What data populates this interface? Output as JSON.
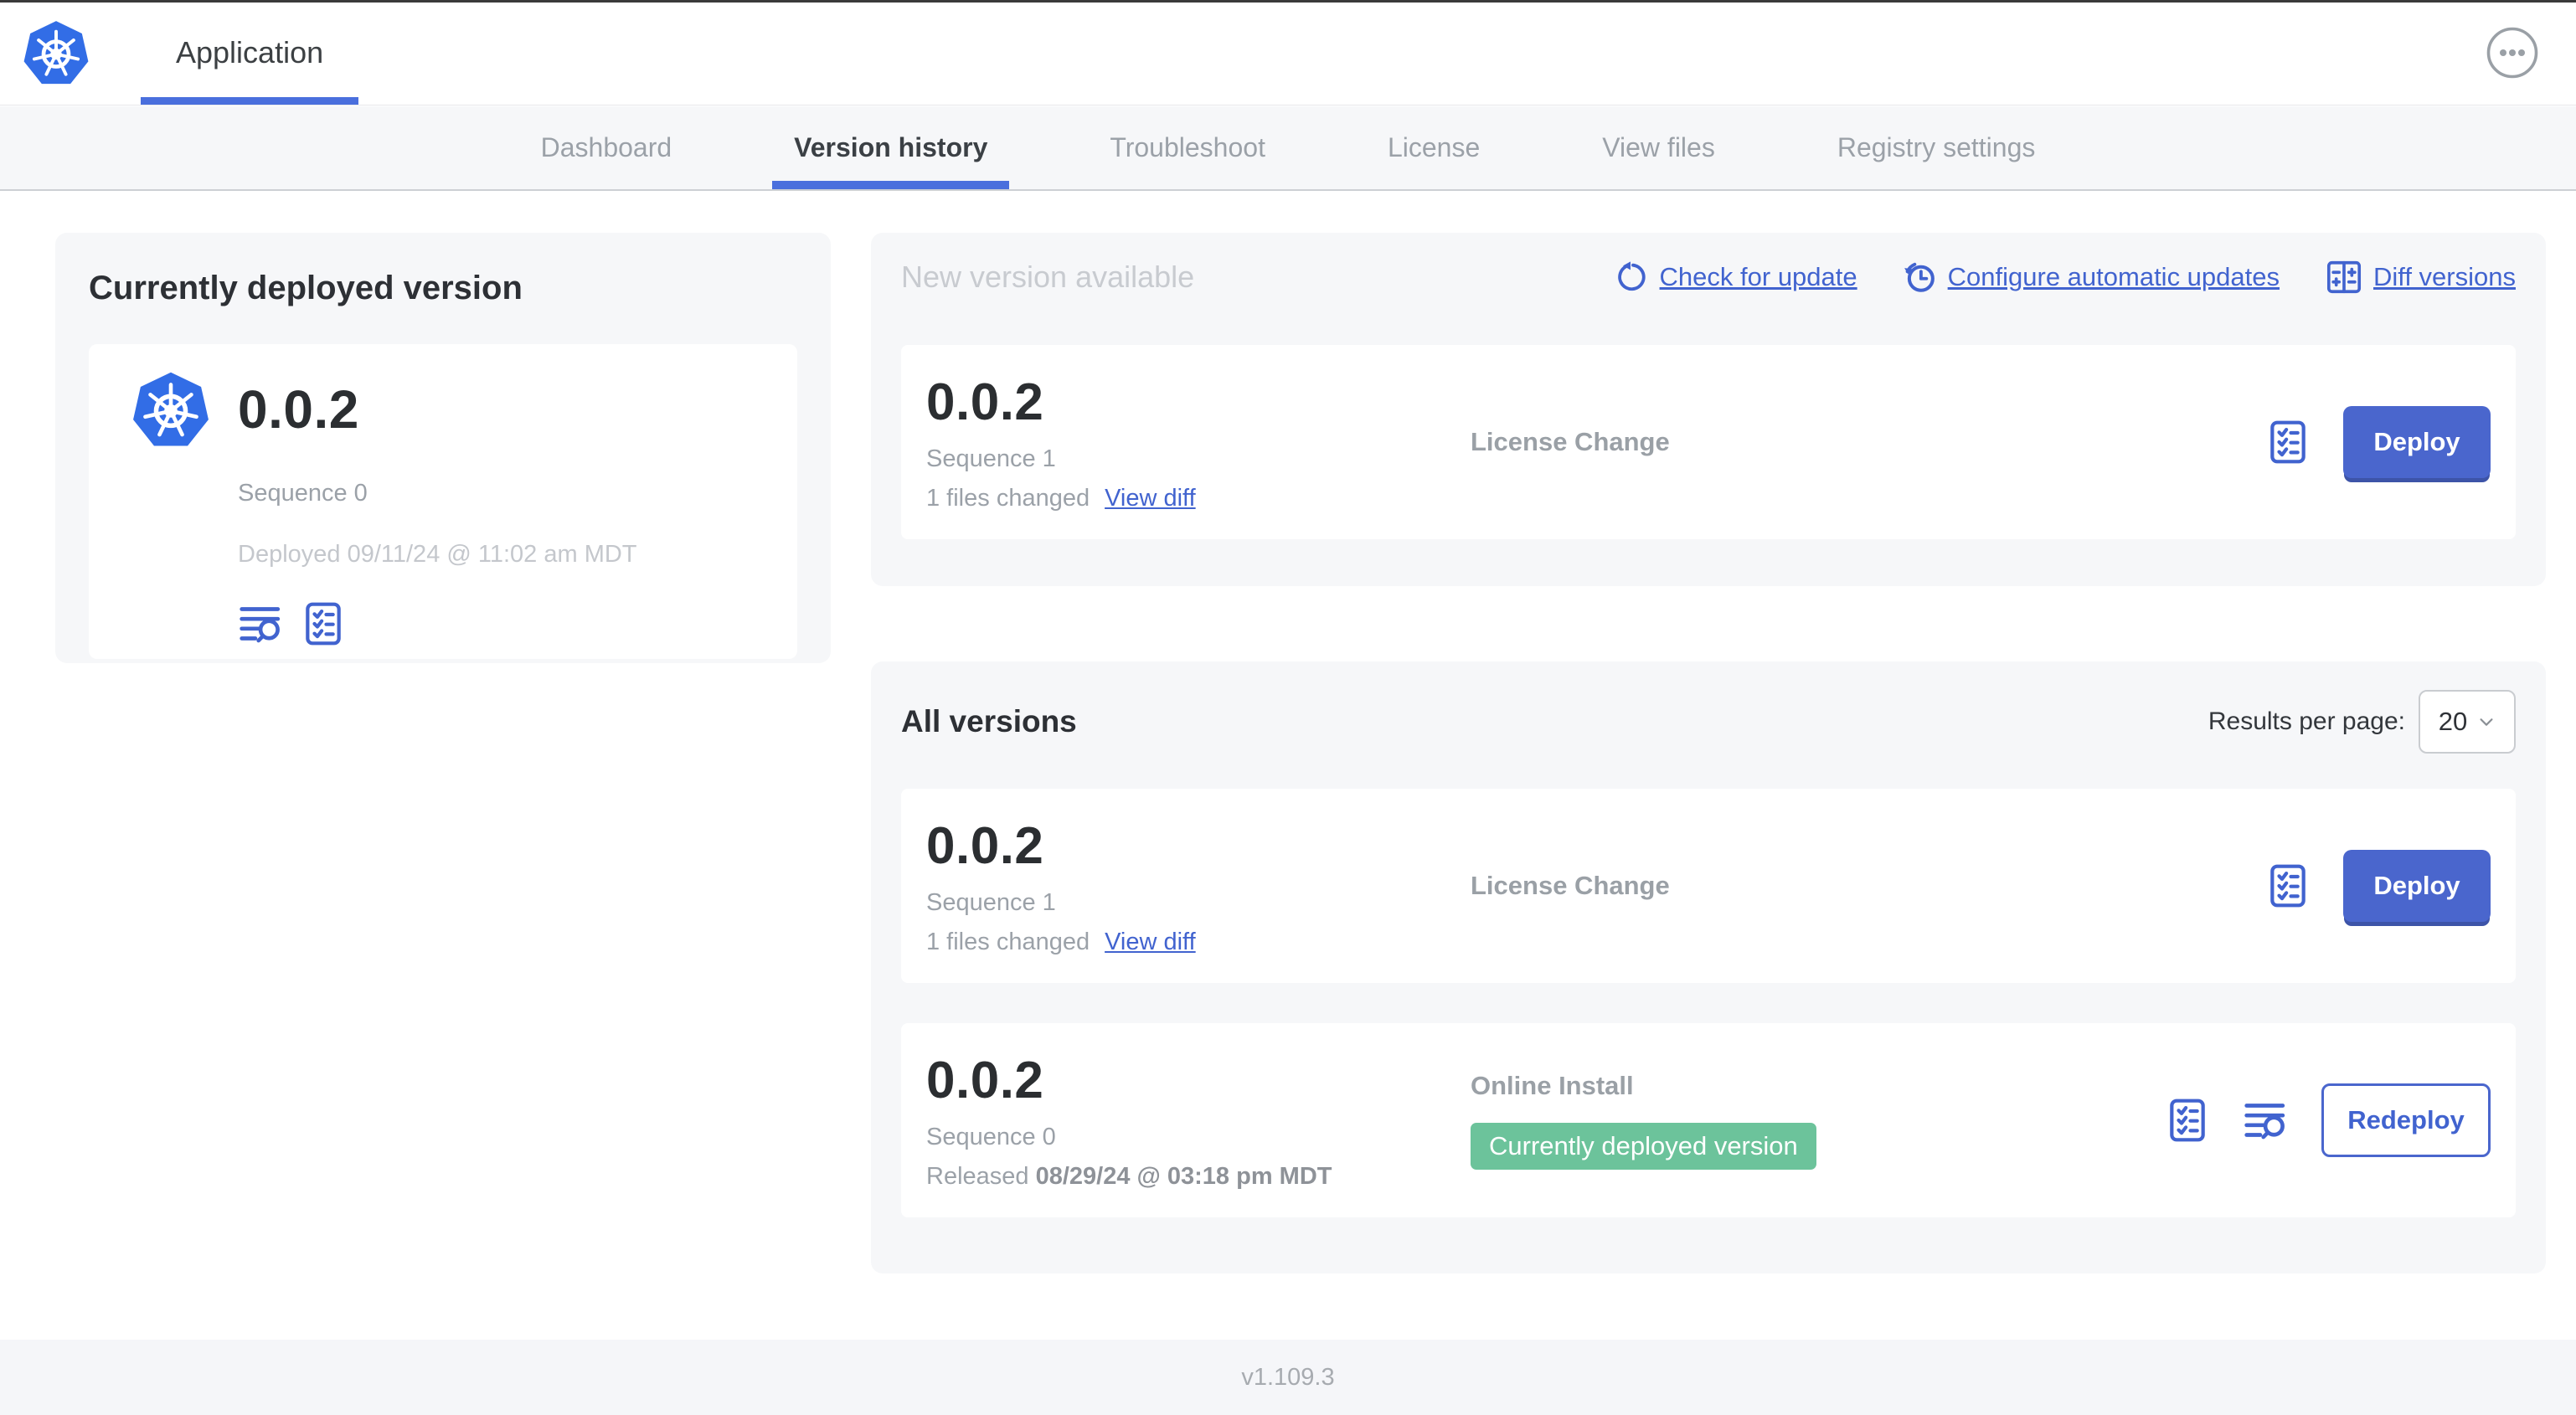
{
  "colors": {
    "primary_blue": "#4a66cd",
    "link_blue": "#4163cf",
    "k8s_blue": "#326de6",
    "badge_green": "#6cc39b",
    "card_bg": "#f6f7f9"
  },
  "header": {
    "app_title": "Application"
  },
  "nav": {
    "tabs": [
      {
        "label": "Dashboard"
      },
      {
        "label": "Version history"
      },
      {
        "label": "Troubleshoot"
      },
      {
        "label": "License"
      },
      {
        "label": "View files"
      },
      {
        "label": "Registry settings"
      }
    ]
  },
  "deployed_card": {
    "title": "Currently deployed version",
    "version": "0.0.2",
    "sequence": "Sequence 0",
    "deployed_at": "Deployed 09/11/24 @ 11:02 am MDT"
  },
  "new_version": {
    "title": "New version available",
    "actions": {
      "check": "Check for update",
      "configure": "Configure automatic updates",
      "diff": "Diff versions"
    },
    "row": {
      "version": "0.0.2",
      "sequence": "Sequence 1",
      "files_changed": "1 files changed",
      "view_diff": "View diff",
      "type": "License Change",
      "deploy_label": "Deploy"
    }
  },
  "all_versions": {
    "title": "All versions",
    "results_per_page_label": "Results per page:",
    "results_per_page_value": "20",
    "rows": [
      {
        "version": "0.0.2",
        "sequence": "Sequence 1",
        "files_changed": "1 files changed",
        "view_diff": "View diff",
        "type": "License Change",
        "action_label": "Deploy"
      },
      {
        "version": "0.0.2",
        "sequence": "Sequence 0",
        "released_prefix": "Released",
        "released_date": "08/29/24 @ 03:18 pm MDT",
        "type": "Online Install",
        "badge": "Currently deployed version",
        "action_label": "Redeploy"
      }
    ]
  },
  "footer": {
    "version": "v1.109.3"
  }
}
